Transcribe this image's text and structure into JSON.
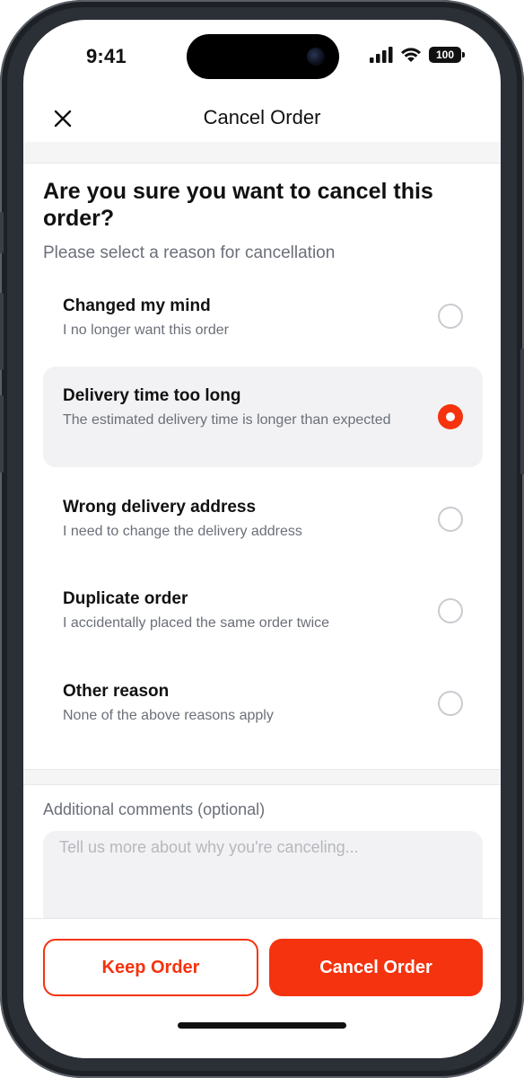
{
  "status_bar": {
    "time": "9:41",
    "battery": "100"
  },
  "header": {
    "title": "Cancel Order"
  },
  "content": {
    "question": "Are you sure you want to cancel this order?",
    "prompt": "Please select a reason for cancellation"
  },
  "reasons": [
    {
      "title": "Changed my mind",
      "description": "I no longer want this order",
      "selected": false
    },
    {
      "title": "Delivery time too long",
      "description": "The estimated delivery time is longer than expected",
      "selected": true
    },
    {
      "title": "Wrong delivery address",
      "description": "I need to change the delivery address",
      "selected": false
    },
    {
      "title": "Duplicate order",
      "description": "I accidentally placed the same order twice",
      "selected": false
    },
    {
      "title": "Other reason",
      "description": "None of the above reasons apply",
      "selected": false
    }
  ],
  "comments": {
    "label": "Additional comments (optional)",
    "placeholder": "Tell us more about why you're canceling...",
    "value": ""
  },
  "footer": {
    "keep_label": "Keep Order",
    "cancel_label": "Cancel Order"
  },
  "colors": {
    "accent": "#f5330e",
    "muted_text": "#6b6f78",
    "selected_bg": "#f2f2f4"
  },
  "icons": {
    "close": "close-icon",
    "signal": "cellular-signal-icon",
    "wifi": "wifi-icon",
    "battery": "battery-icon"
  }
}
